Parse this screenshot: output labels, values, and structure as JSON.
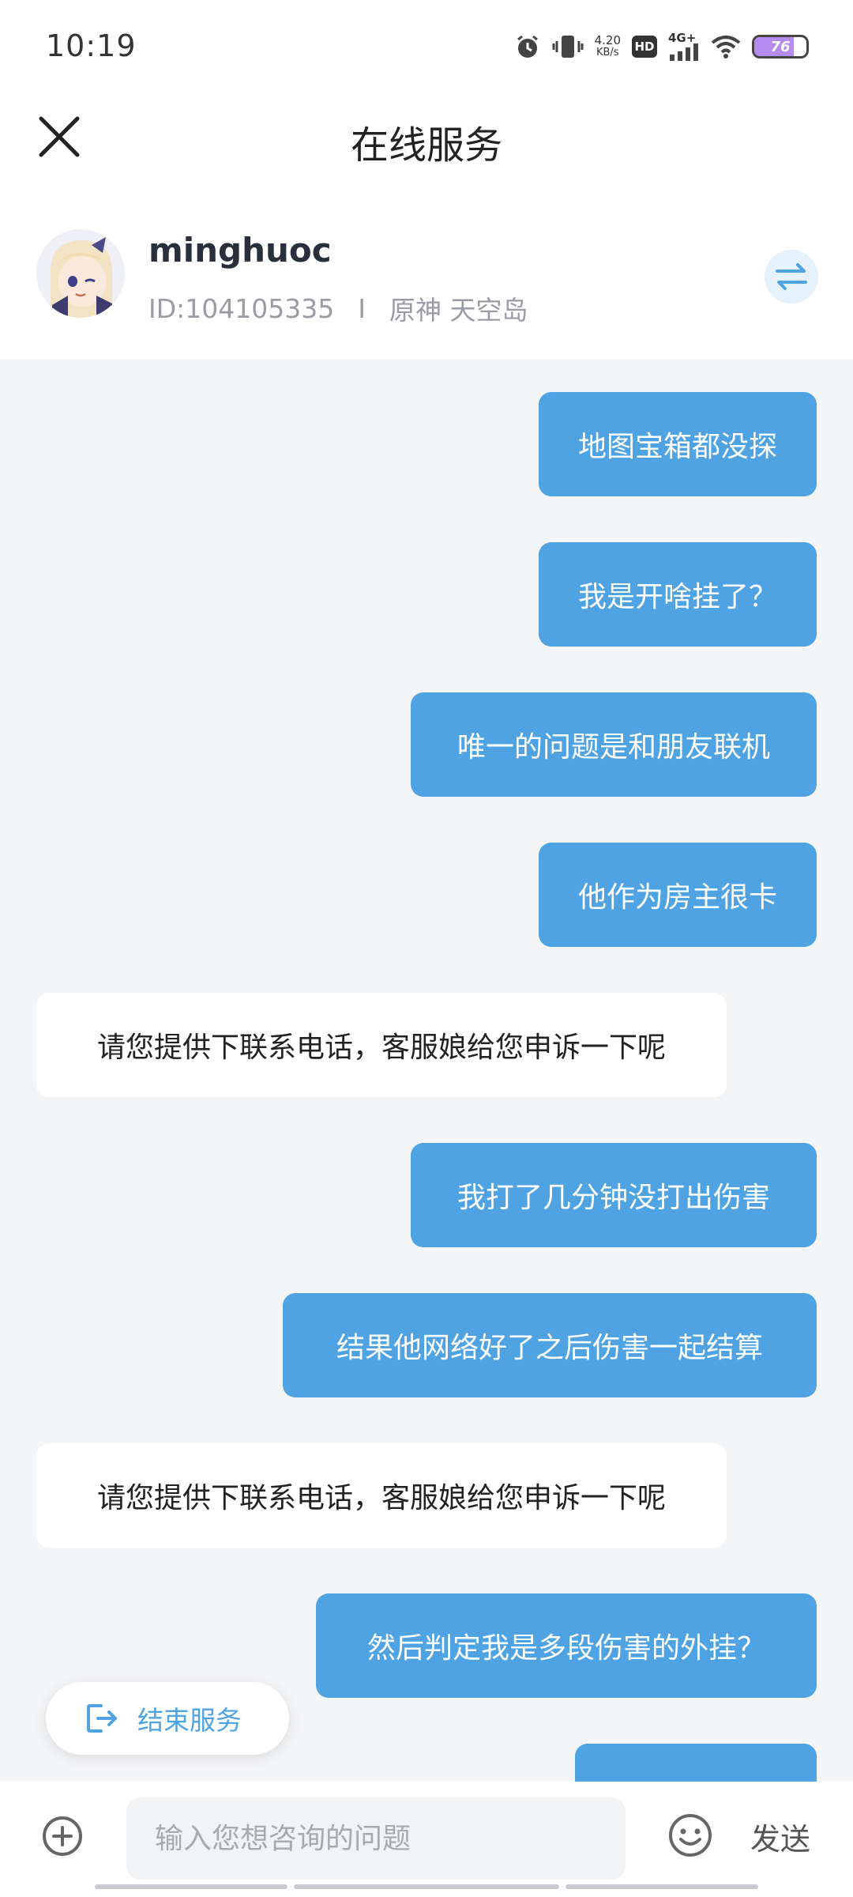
{
  "status_bar": {
    "time": "10:19",
    "net_speed_value": "4.20",
    "net_speed_unit": "KB/s",
    "hd_label": "HD",
    "network_label": "4G+",
    "battery_level": "76",
    "battery_fill_percent": 76
  },
  "header": {
    "title": "在线服务",
    "close_icon": "close-icon"
  },
  "profile": {
    "username": "minghuoc",
    "user_id": "ID:104105335",
    "separator": "I",
    "server": "原神 天空岛",
    "switch_icon": "swap-arrows-icon"
  },
  "messages": [
    {
      "side": "out",
      "text": "地图宝箱都没探"
    },
    {
      "side": "out",
      "text": "我是开啥挂了？"
    },
    {
      "side": "out",
      "text": "唯一的问题是和朋友联机"
    },
    {
      "side": "out",
      "text": "他作为房主很卡"
    },
    {
      "side": "in",
      "text": "请您提供下联系电话，客服娘给您申诉一下呢"
    },
    {
      "side": "out",
      "text": "我打了几分钟没打出伤害"
    },
    {
      "side": "out",
      "text": "结果他网络好了之后伤害一起结算"
    },
    {
      "side": "in",
      "text": "请您提供下联系电话，客服娘给您申诉一下呢"
    },
    {
      "side": "out",
      "text": "然后判定我是多段伤害的外挂？"
    },
    {
      "side": "out",
      "text": ""
    }
  ],
  "end_service": {
    "label": "结束服务",
    "icon": "exit-icon"
  },
  "input_bar": {
    "placeholder": "输入您想咨询的问题",
    "send_label": "发送",
    "plus_icon": "plus-icon",
    "emoji_icon": "emoji-icon"
  },
  "colors": {
    "accent": "#4fa3e3",
    "background": "#f4f5f7",
    "incoming_bubble": "#ffffff"
  }
}
